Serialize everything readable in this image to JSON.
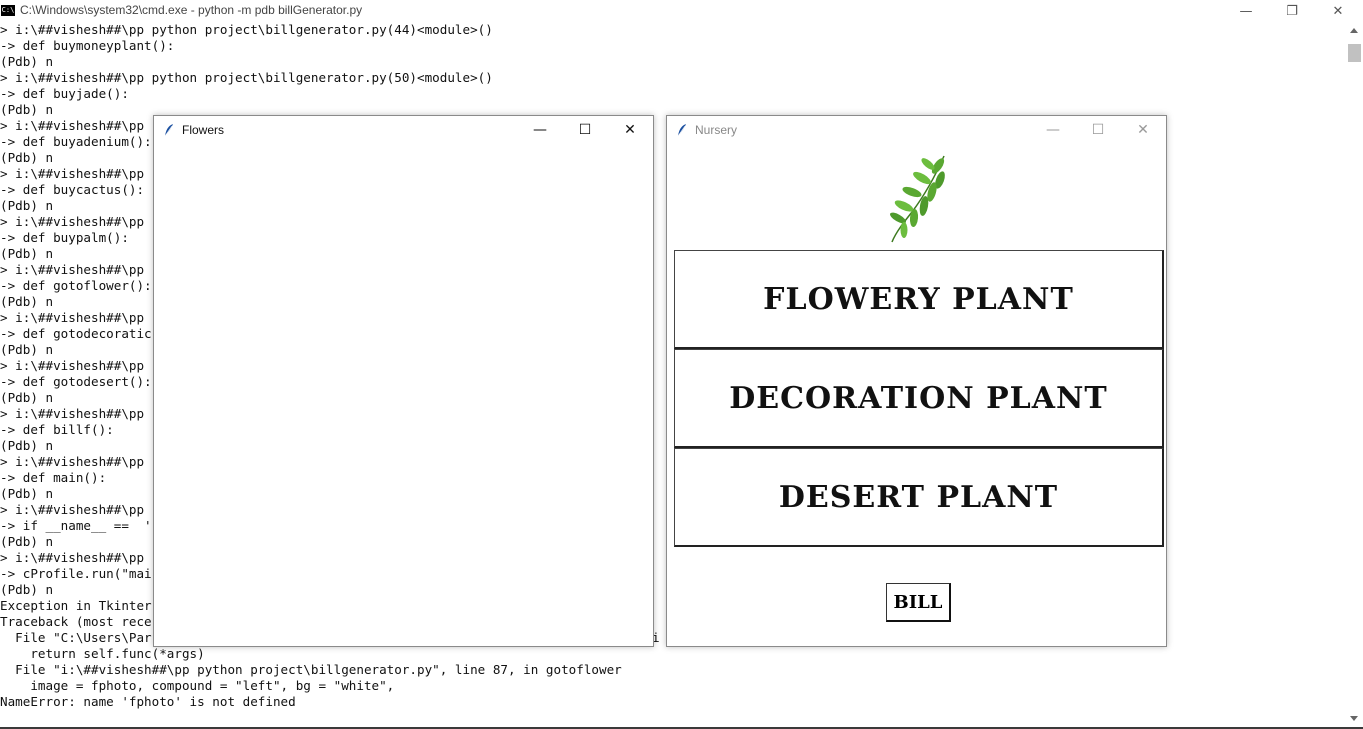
{
  "cmd": {
    "title": "C:\\Windows\\system32\\cmd.exe - python  -m pdb billGenerator.py",
    "icon_text": "C:\\"
  },
  "console_lines": [
    "> i:\\##vishesh##\\pp python project\\billgenerator.py(44)<module>()",
    "-> def buymoneyplant():",
    "(Pdb) n",
    "> i:\\##vishesh##\\pp python project\\billgenerator.py(50)<module>()",
    "-> def buyjade():",
    "(Pdb) n",
    "> i:\\##vishesh##\\pp",
    "-> def buyadenium():",
    "(Pdb) n",
    "> i:\\##vishesh##\\pp",
    "-> def buycactus():",
    "(Pdb) n",
    "> i:\\##vishesh##\\pp",
    "-> def buypalm():",
    "(Pdb) n",
    "> i:\\##vishesh##\\pp",
    "-> def gotoflower():",
    "(Pdb) n",
    "> i:\\##vishesh##\\pp",
    "-> def gotodecoratic",
    "(Pdb) n",
    "> i:\\##vishesh##\\pp",
    "-> def gotodesert():",
    "(Pdb) n",
    "> i:\\##vishesh##\\pp",
    "-> def billf():",
    "(Pdb) n",
    "> i:\\##vishesh##\\pp",
    "-> def main():",
    "(Pdb) n",
    "> i:\\##vishesh##\\pp",
    "-> if __name__ ==  '",
    "(Pdb) n",
    "> i:\\##vishesh##\\pp",
    "-> cProfile.run(\"mai",
    "(Pdb) n",
    "Exception in Tkinter",
    "Traceback (most rece",
    "  File \"C:\\Users\\Par                                                                 ki",
    "    return self.func(*args)",
    "  File \"i:\\##vishesh##\\pp python project\\billgenerator.py\", line 87, in gotoflower",
    "    image = fphoto, compound = \"left\", bg = \"white\",",
    "NameError: name 'fphoto' is not defined"
  ],
  "flowers_window": {
    "title": "Flowers"
  },
  "nursery_window": {
    "title": "Nursery",
    "buttons": {
      "flowery": "FLOWERY PLANT",
      "decoration": "DECORATION PLANT",
      "desert": "DESERT PLANT",
      "bill": "BILL"
    }
  },
  "window_controls": {
    "minimize": "—",
    "maximize": "☐",
    "restore": "❐",
    "close": "✕"
  },
  "colors": {
    "leaf": "#5aa832",
    "stem": "#3d7a1f",
    "feather": "#1a4fa0"
  }
}
